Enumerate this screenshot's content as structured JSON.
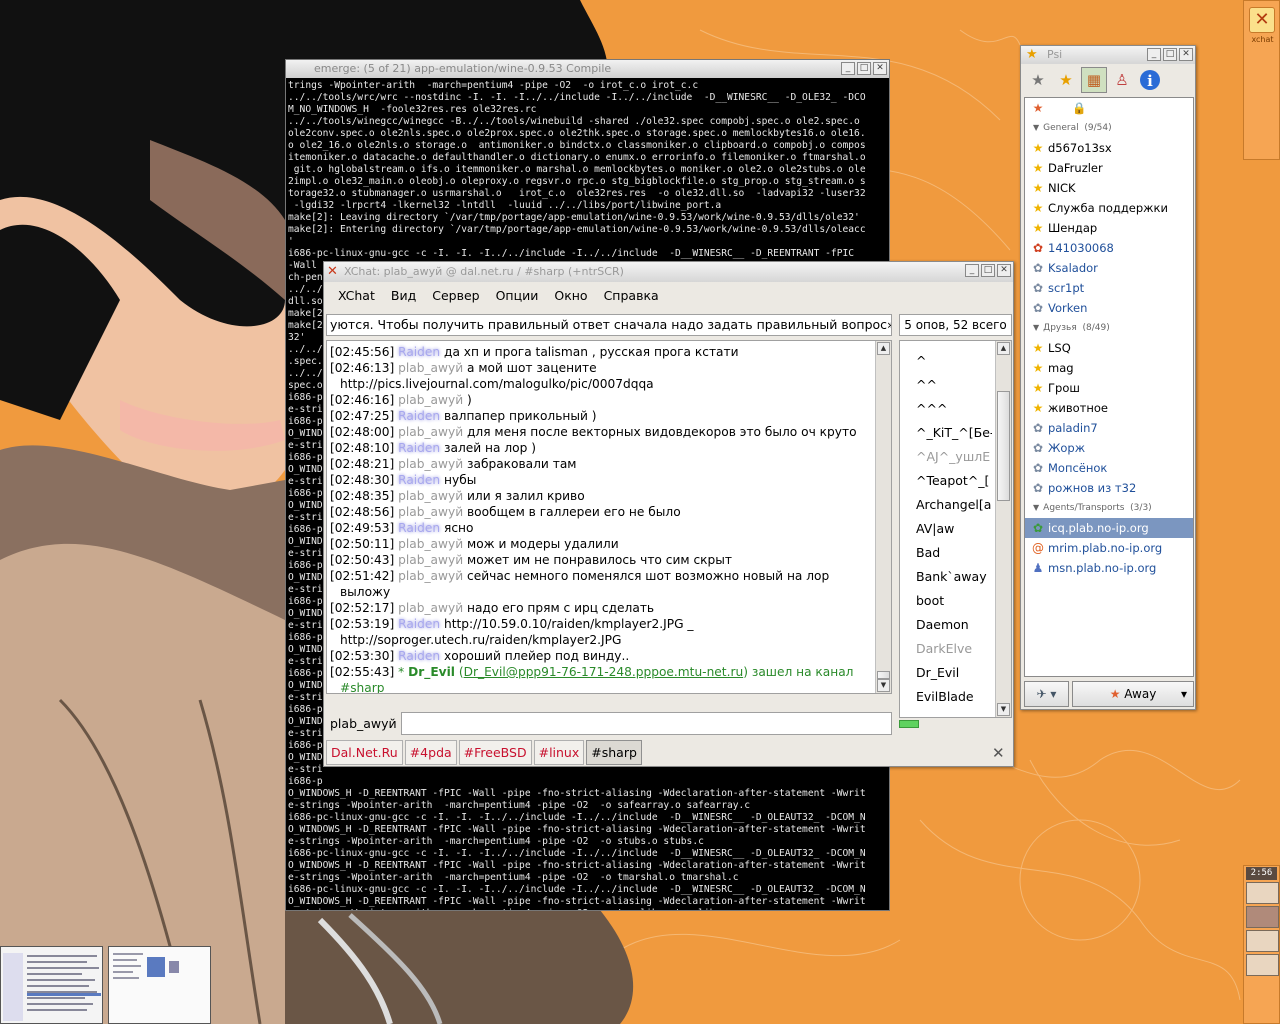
{
  "terminal": {
    "title": "emerge: (5 of 21) app-emulation/wine-0.9.53 Compile",
    "lines": [
      "trings -Wpointer-arith  -march=pentium4 -pipe -O2  -o irot_c.o irot_c.c",
      "../../tools/wrc/wrc --nostdinc -I. -I. -I../../include -I../../include  -D__WINESRC__ -D_OLE32_ -DCO",
      "M_NO_WINDOWS_H  -foole32res.res ole32res.rc",
      "../../tools/winegcc/winegcc -B../../tools/winebuild -shared ./ole32.spec compobj.spec.o ole2.spec.o",
      "ole2conv.spec.o ole2nls.spec.o ole2prox.spec.o ole2thk.spec.o storage.spec.o memlockbytes16.o ole16.",
      "o ole2_16.o ole2nls.o storage.o  antimoniker.o bindctx.o classmoniker.o clipboard.o compobj.o compos",
      "itemoniker.o datacache.o defaulthandler.o dictionary.o enumx.o errorinfo.o filemoniker.o ftmarshal.o",
      " git.o hglobalstream.o ifs.o itemmoniker.o marshal.o memlockbytes.o moniker.o ole2.o ole2stubs.o ole",
      "2impl.o ole32_main.o oleobj.o oleproxy.o regsvr.o rpc.o stg_bigblockfile.o stg_prop.o stg_stream.o s",
      "torage32.o stubmanager.o usrmarshal.o   irot_c.o  ole32res.res  -o ole32.dll.so  -ladvapi32 -luser32",
      " -lgdi32 -lrpcrt4 -lkernel32 -lntdll  -luuid ../../libs/port/libwine_port.a",
      "make[2]: Leaving directory `/var/tmp/portage/app-emulation/wine-0.9.53/work/wine-0.9.53/dlls/ole32'",
      "make[2]: Entering directory `/var/tmp/portage/app-emulation/wine-0.9.53/work/wine-0.9.53/dlls/oleacc",
      "'",
      "i686-pc-linux-gnu-gcc -c -I. -I. -I../../include -I../../include  -D__WINESRC__ -D_REENTRANT -fPIC",
      "-Wall",
      "ch-pen",
      "../../",
      "dll.so",
      "make[2",
      "make[2",
      "32'",
      "../../",
      ".spec.",
      "../../",
      "spec.o",
      "i686-p",
      "e-stri",
      "i686-p",
      "O_WIND",
      "e-stri",
      "i686-p",
      "O_WIND",
      "e-stri",
      "i686-p",
      "O_WIND",
      "e-stri",
      "i686-p",
      "O_WIND",
      "e-stri",
      "i686-p",
      "O_WIND",
      "e-stri",
      "i686-p",
      "O_WIND",
      "e-stri",
      "i686-p",
      "O_WIND",
      "e-stri",
      "i686-p",
      "O_WIND",
      "e-stri",
      "i686-p",
      "O_WIND",
      "e-stri",
      "i686-p",
      "O_WIND",
      "e-stri",
      "i686-p",
      "O_WINDOWS_H -D_REENTRANT -fPIC -Wall -pipe -fno-strict-aliasing -Wdeclaration-after-statement -Wwrit",
      "e-strings -Wpointer-arith  -march=pentium4 -pipe -O2  -o safearray.o safearray.c",
      "i686-pc-linux-gnu-gcc -c -I. -I. -I../../include -I../../include  -D__WINESRC__ -D_OLEAUT32_ -DCOM_N",
      "O_WINDOWS_H -D_REENTRANT -fPIC -Wall -pipe -fno-strict-aliasing -Wdeclaration-after-statement -Wwrit",
      "e-strings -Wpointer-arith  -march=pentium4 -pipe -O2  -o stubs.o stubs.c",
      "i686-pc-linux-gnu-gcc -c -I. -I. -I../../include -I../../include  -D__WINESRC__ -D_OLEAUT32_ -DCOM_N",
      "O_WINDOWS_H -D_REENTRANT -fPIC -Wall -pipe -fno-strict-aliasing -Wdeclaration-after-statement -Wwrit",
      "e-strings -Wpointer-arith  -march=pentium4 -pipe -O2  -o tmarshal.o tmarshal.c",
      "i686-pc-linux-gnu-gcc -c -I. -I. -I../../include -I../../include  -D__WINESRC__ -D_OLEAUT32_ -DCOM_N",
      "O_WINDOWS_H -D_REENTRANT -fPIC -Wall -pipe -fno-strict-aliasing -Wdeclaration-after-statement -Wwrit",
      "e-strings -Wpointer-arith  -march=pentium4 -pipe -O2  -o typelib.o typelib.c"
    ]
  },
  "xchat": {
    "title": "XChat: plab_awyй @ dal.net.ru / #sharp (+ntrSCR)",
    "menu": [
      "XChat",
      "Вид",
      "Сервер",
      "Опции",
      "Окно",
      "Справка"
    ],
    "topic": "уются. Чтобы получить правильный ответ сначала надо задать правильный вопрос»",
    "user_count": "5 опов, 52 всего",
    "messages": [
      {
        "time": "[02:45:56]",
        "nick": "Raiden",
        "blur": true,
        "text": "да хп и прога talisman , русская прога кстати"
      },
      {
        "time": "[02:46:13]",
        "nick": "plab_awyй",
        "blur": false,
        "text": "а мой шот зацените http://pics.livejournal.com/malogulko/pic/0007dqqa"
      },
      {
        "time": "[02:46:16]",
        "nick": "plab_awyй",
        "blur": false,
        "text": ")"
      },
      {
        "time": "[02:47:25]",
        "nick": "Raiden",
        "blur": true,
        "text": "валпапер прикольный )"
      },
      {
        "time": "[02:48:00]",
        "nick": "plab_awyй",
        "blur": false,
        "text": "для меня после векторных видовдекоров это было оч круто"
      },
      {
        "time": "[02:48:10]",
        "nick": "Raiden",
        "blur": true,
        "text": "залей на лор )"
      },
      {
        "time": "[02:48:21]",
        "nick": "plab_awyй",
        "blur": false,
        "text": "забраковали там"
      },
      {
        "time": "[02:48:30]",
        "nick": "Raiden",
        "blur": true,
        "text": "нубы"
      },
      {
        "time": "[02:48:35]",
        "nick": "plab_awyй",
        "blur": false,
        "text": "или я залил криво"
      },
      {
        "time": "[02:48:56]",
        "nick": "plab_awyй",
        "blur": false,
        "text": "вообщем в галлереи его не было"
      },
      {
        "time": "[02:49:53]",
        "nick": "Raiden",
        "blur": true,
        "text": "ясно"
      },
      {
        "time": "[02:50:11]",
        "nick": "plab_awyй",
        "blur": false,
        "text": "мож и модеры удалили"
      },
      {
        "time": "[02:50:43]",
        "nick": "plab_awyй",
        "blur": false,
        "text": "может им не понравилось что сим скрыт"
      },
      {
        "time": "[02:51:42]",
        "nick": "plab_awyй",
        "blur": false,
        "text": "сейчас немного поменялся шот возможно новый на лор выложу"
      },
      {
        "time": "[02:52:17]",
        "nick": "plab_awyй",
        "blur": false,
        "text": "надо его прям с ирц сделать"
      },
      {
        "time": "[02:53:19]",
        "nick": "Raiden",
        "blur": true,
        "text": "http://10.59.0.10/raiden/kmplayer2.JPG  _  http://soproger.utech.ru/raiden/kmplayer2.JPG"
      },
      {
        "time": "[02:53:30]",
        "nick": "Raiden",
        "blur": true,
        "text": "хороший плейер под винду.."
      }
    ],
    "join": {
      "time": "[02:55:43]",
      "star": "*",
      "nick": "Dr_Evil",
      "host": "Dr_Evil@ppp91-76-171-248.pppoe.mtu-net.ru",
      "text": "зашел на канал #sharp"
    },
    "nicks": [
      {
        "name": "^",
        "away": false
      },
      {
        "name": "^^",
        "away": false
      },
      {
        "name": "^^^",
        "away": false
      },
      {
        "name": "^_KiT_^[Бе-",
        "away": false
      },
      {
        "name": "^AJ^_ушлЕ",
        "away": true
      },
      {
        "name": "^Teapot^_[",
        "away": false
      },
      {
        "name": "Archangel[a",
        "away": false
      },
      {
        "name": "AV|aw",
        "away": false
      },
      {
        "name": "Bad",
        "away": false
      },
      {
        "name": "Bank`away",
        "away": false
      },
      {
        "name": "boot",
        "away": false
      },
      {
        "name": "Daemon",
        "away": false
      },
      {
        "name": "DarkElve",
        "away": true
      },
      {
        "name": "Dr_Evil",
        "away": false
      },
      {
        "name": "EvilBlade",
        "away": false
      }
    ],
    "my_nick": "plab_awyй",
    "tabs": [
      "Dal.Net.Ru",
      "#4pda",
      "#FreeBSD",
      "#linux",
      "#sharp"
    ],
    "active_tab": "#sharp",
    "close_label": "✕"
  },
  "psi": {
    "title": "Psi",
    "groups": [
      {
        "label": "General",
        "count": "(9/54)",
        "items": [
          {
            "name": "d567o13sx",
            "blue": false,
            "icon": "star-icon"
          },
          {
            "name": "DaFruzler",
            "blue": false,
            "icon": "star-icon"
          },
          {
            "name": "NICK",
            "blue": false,
            "icon": "star-icon"
          },
          {
            "name": "Служба поддержки",
            "blue": false,
            "icon": "star-icon"
          },
          {
            "name": "Шендар",
            "blue": false,
            "icon": "star-icon"
          },
          {
            "name": "141030068",
            "blue": true,
            "icon": "icq-icon"
          },
          {
            "name": "Ksalador",
            "blue": true,
            "icon": "offline-icon"
          },
          {
            "name": "scr1pt",
            "blue": true,
            "icon": "offline-icon"
          },
          {
            "name": "Vorken",
            "blue": true,
            "icon": "offline-icon"
          }
        ]
      },
      {
        "label": "Друзья",
        "count": "(8/49)",
        "items": [
          {
            "name": "LSQ",
            "blue": false,
            "icon": "star-icon"
          },
          {
            "name": "mag",
            "blue": false,
            "icon": "star-icon"
          },
          {
            "name": "Грош",
            "blue": false,
            "icon": "star-icon"
          },
          {
            "name": "животное",
            "blue": false,
            "icon": "star-icon"
          },
          {
            "name": "paladin7",
            "blue": true,
            "icon": "offline-icon"
          },
          {
            "name": "Жорж",
            "blue": true,
            "icon": "offline-icon"
          },
          {
            "name": "Мопсёнок",
            "blue": true,
            "icon": "offline-icon"
          },
          {
            "name": "рожнов из т32",
            "blue": true,
            "icon": "offline-icon"
          }
        ]
      },
      {
        "label": "Agents/Transports",
        "count": "(3/3)",
        "items": [
          {
            "name": "icq.plab.no-ip.org",
            "blue": false,
            "icon": "icq-transport-icon",
            "selected": true
          },
          {
            "name": "mrim.plab.no-ip.org",
            "blue": true,
            "icon": "mrim-transport-icon"
          },
          {
            "name": "msn.plab.no-ip.org",
            "blue": true,
            "icon": "msn-transport-icon"
          }
        ]
      }
    ],
    "status_label": "Away"
  },
  "dock": {
    "top_label": "xchat",
    "clock": "2:56"
  },
  "colors": {
    "desktop": "#f09a3e",
    "selection": "#7b96c0",
    "tab_unread": "#c8102e",
    "join": "#2a8a2a"
  }
}
